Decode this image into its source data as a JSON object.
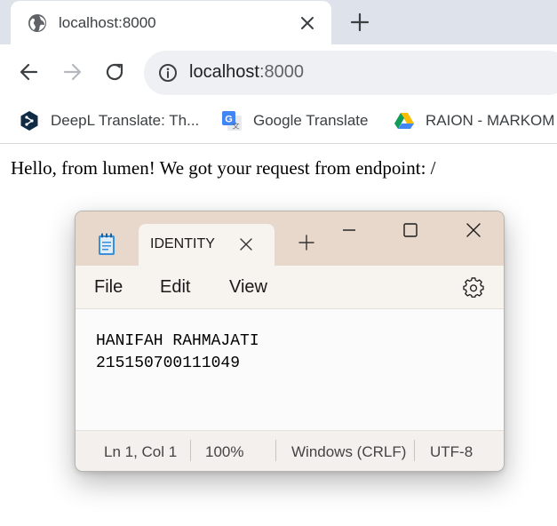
{
  "browser": {
    "tab": {
      "title": "localhost:8000",
      "favicon": "globe-icon"
    },
    "address_bar": {
      "host": "localhost",
      "port": ":8000"
    },
    "bookmarks": [
      {
        "label": "DeepL Translate: Th...",
        "icon": "deepl-icon"
      },
      {
        "label": "Google Translate",
        "icon": "google-translate-icon"
      },
      {
        "label": "RAION - MARKOM",
        "icon": "google-drive-icon"
      }
    ]
  },
  "page": {
    "message": "Hello, from lumen! We got your request from endpoint: /"
  },
  "notepad": {
    "tab_title": "IDENTITY",
    "menu": {
      "file": "File",
      "edit": "Edit",
      "view": "View"
    },
    "content": [
      "HANIFAH RAHMAJATI",
      "215150700111049"
    ],
    "status": {
      "position": "Ln 1, Col 1",
      "zoom": "100%",
      "line_ending": "Windows (CRLF)",
      "encoding": "UTF-8"
    }
  }
}
